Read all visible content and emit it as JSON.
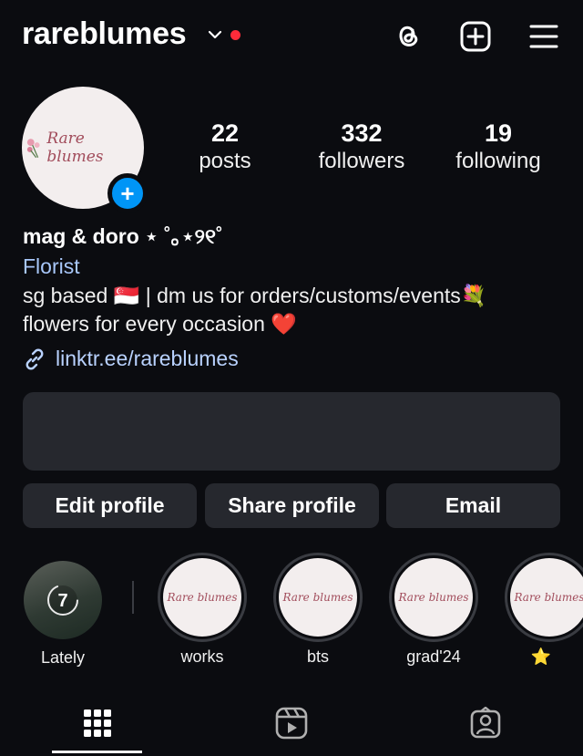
{
  "header": {
    "username": "rareblumes",
    "icons": [
      "chevron-down-icon",
      "threads-icon",
      "create-icon",
      "menu-icon"
    ]
  },
  "profile": {
    "avatar_logo": "Rare blumes",
    "stats": [
      {
        "value": "22",
        "label": "posts"
      },
      {
        "value": "332",
        "label": "followers"
      },
      {
        "value": "19",
        "label": "following"
      }
    ],
    "display_name": "mag & doro ⋆ ˚｡⋆୨୧˚",
    "category": "Florist",
    "bio_line1": "sg based 🇸🇬 | dm us for orders/customs/events💐",
    "bio_line2": "flowers for every occasion ❤️",
    "link": "linktr.ee/rareblumes"
  },
  "buttons": {
    "edit": "Edit profile",
    "share": "Share profile",
    "email": "Email"
  },
  "highlights": [
    {
      "label": "Lately",
      "badge": "7"
    },
    {
      "label": "works"
    },
    {
      "label": "bts"
    },
    {
      "label": "grad'24"
    },
    {
      "label": "⭐"
    }
  ],
  "colors": {
    "background": "#0b0c10",
    "accent": "#0095f6",
    "link": "#a8c7fa",
    "notification": "#ff2b3a"
  }
}
